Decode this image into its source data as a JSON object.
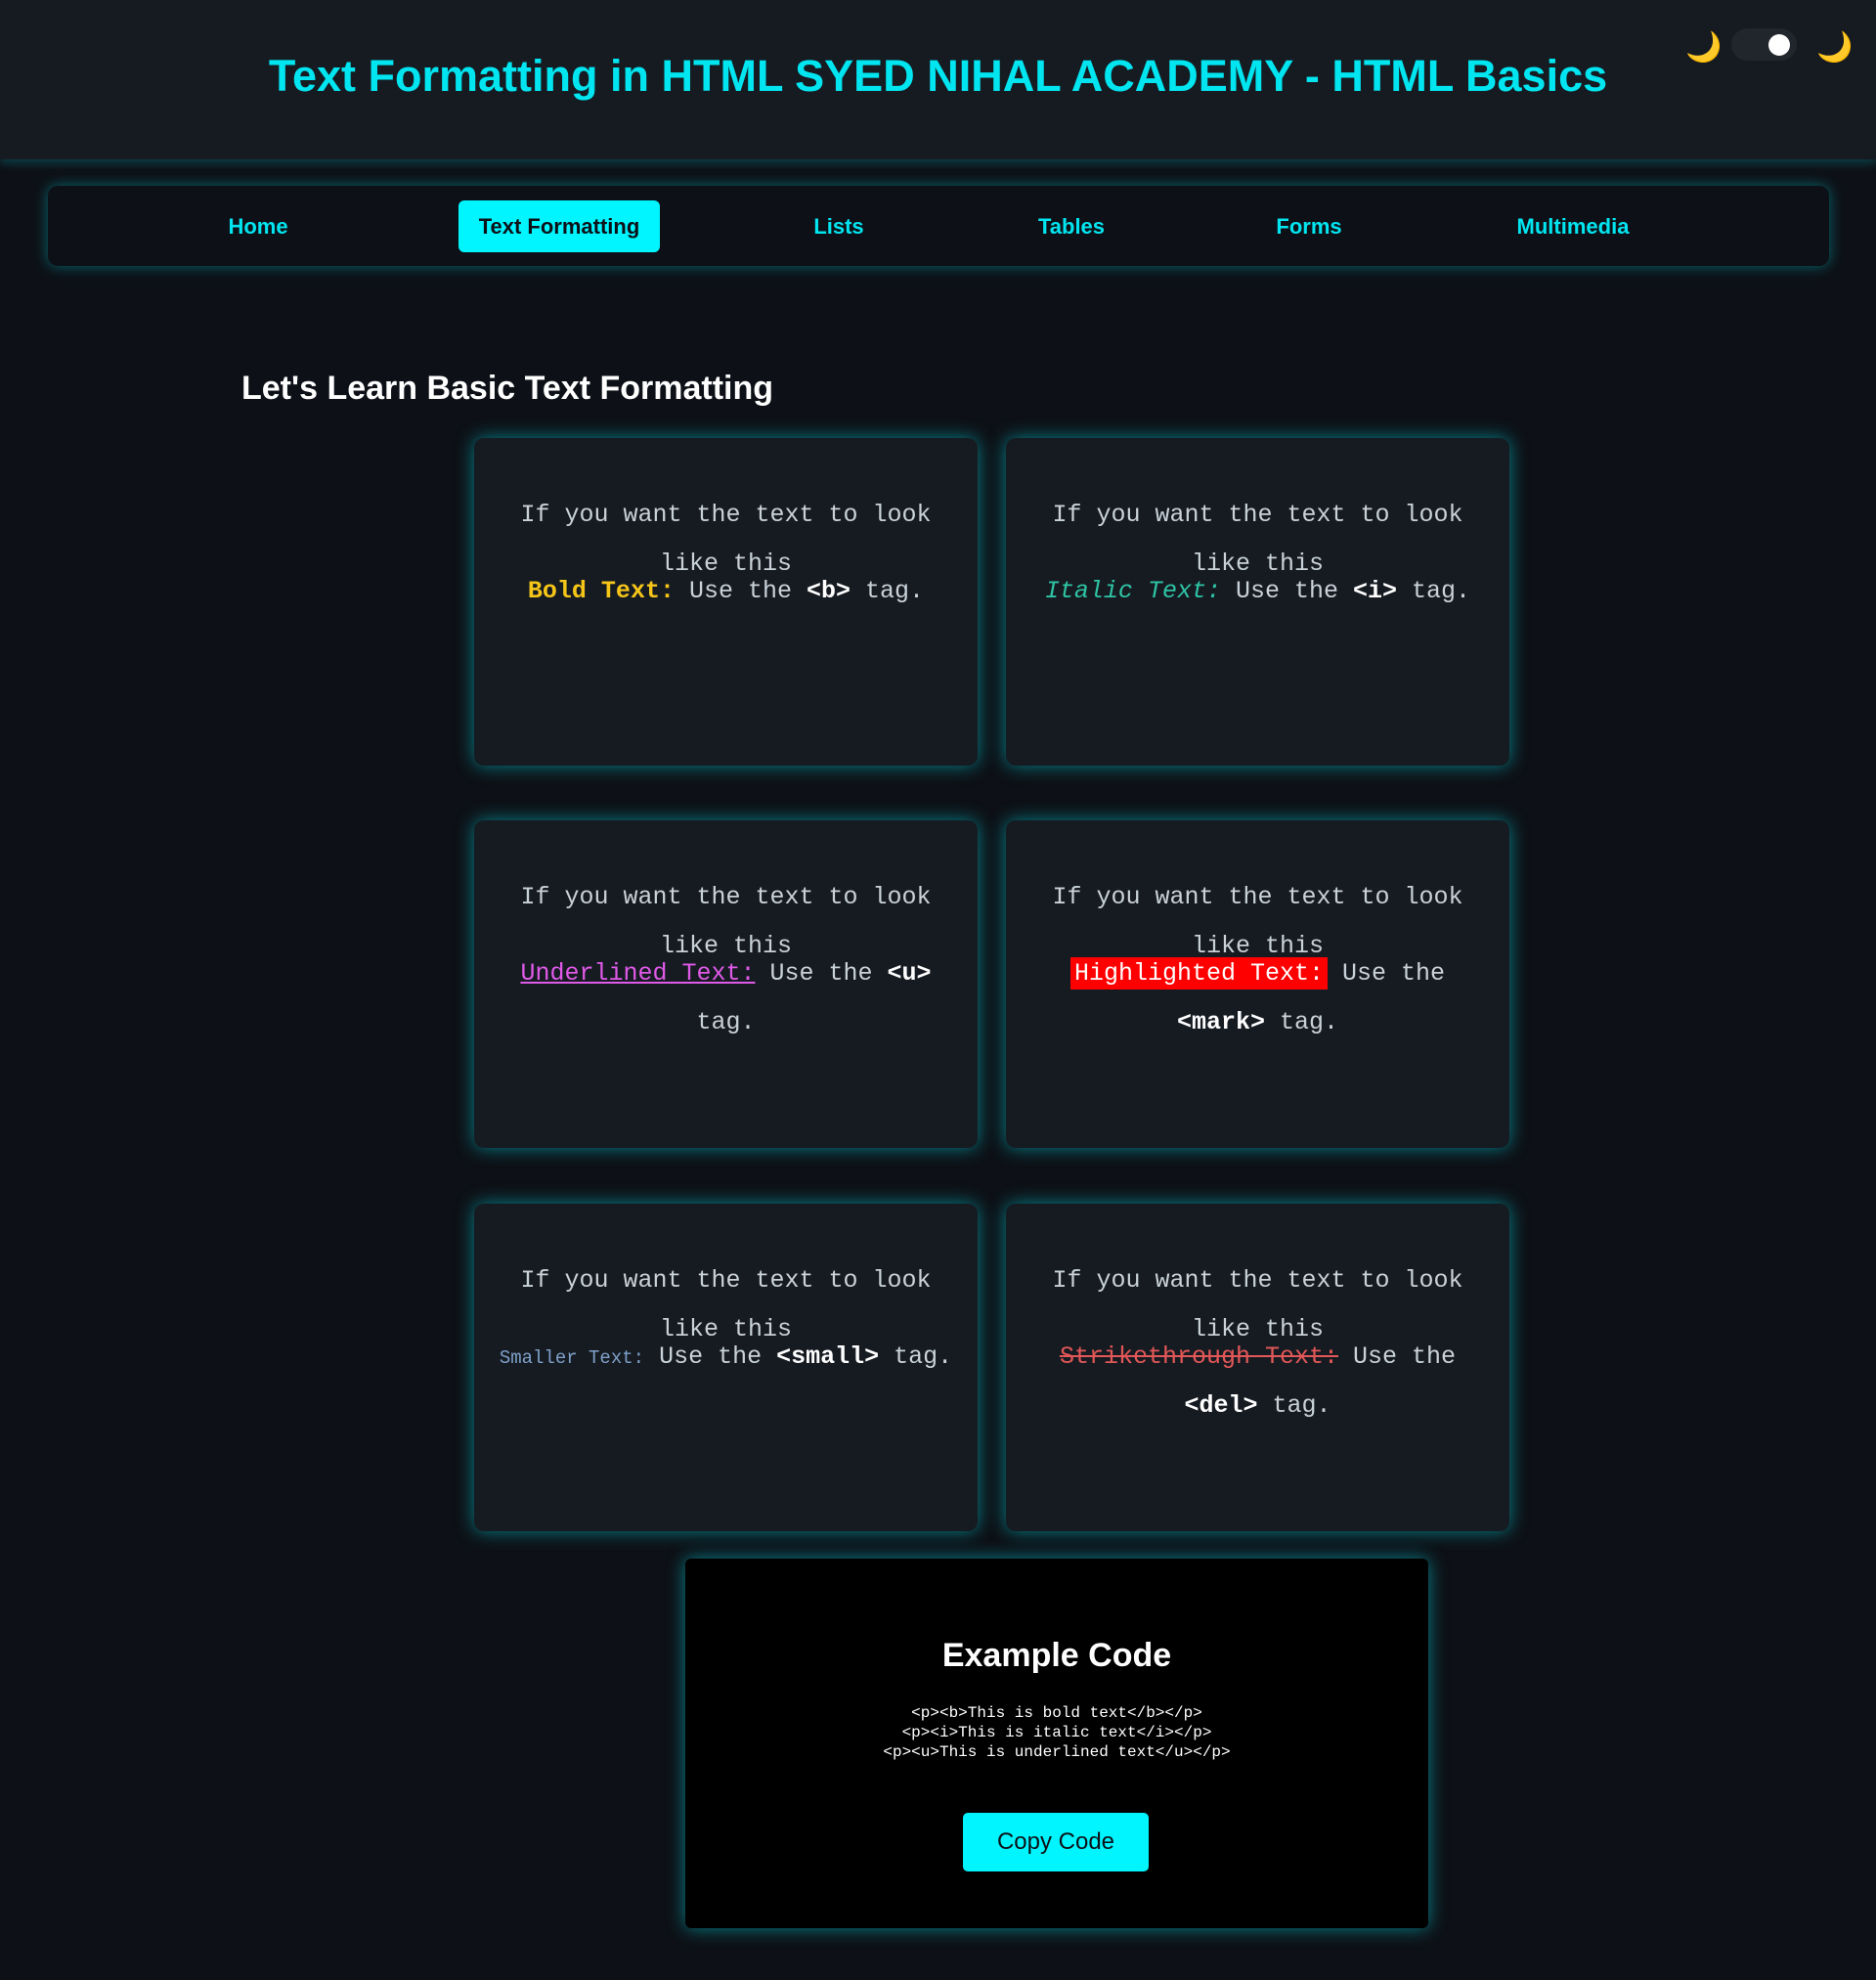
{
  "header": {
    "title": "Text Formatting in HTML SYED NIHAL ACADEMY - HTML Basics",
    "theme_toggle": {
      "left_icon": "🌙",
      "right_icon": "🌙",
      "state": "on"
    }
  },
  "nav": {
    "items": [
      {
        "label": "Home"
      },
      {
        "label": "Text Formatting",
        "active": true
      },
      {
        "label": "Lists"
      },
      {
        "label": "Tables"
      },
      {
        "label": "Forms"
      },
      {
        "label": "Multimedia"
      }
    ]
  },
  "main": {
    "heading": "Let's Learn Basic Text Formatting",
    "cards": [
      {
        "intro": "If you want the text to look like this",
        "label": "Bold Text:",
        "use": "Use the",
        "tag": "<b>",
        "suffix": "tag."
      },
      {
        "intro": "If you want the text to look like this",
        "label": "Italic Text:",
        "use": "Use the",
        "tag": "<i>",
        "suffix": "tag."
      },
      {
        "intro": "If you want the text to look like this",
        "label": "Underlined Text:",
        "use": "Use the",
        "tag": "<u>",
        "suffix": "tag."
      },
      {
        "intro": "If you want the text to look like this",
        "label": "Highlighted Text:",
        "use": "Use the",
        "tag": "<mark>",
        "suffix": "tag."
      },
      {
        "intro": "If you want the text to look like this",
        "label": "Smaller Text:",
        "use": "Use the",
        "tag": "<small>",
        "suffix": "tag."
      },
      {
        "intro": "If you want the text to look like this",
        "label": "Strikethrough Text:",
        "use": "Use the",
        "tag": "<del>",
        "suffix": "tag."
      }
    ]
  },
  "example": {
    "title": "Example Code",
    "lines": [
      "<p><b>This is bold text</b></p>",
      "<p><i>This is italic text</i></p>",
      "<p><u>This is underlined text</u></p>"
    ],
    "copy_label": "Copy Code"
  },
  "colors": {
    "accent": "#00f5ff",
    "background": "#0d1117",
    "card": "#161b22",
    "bold": "#f5c518",
    "italic": "#2ec4a4",
    "underline": "#e05ae8",
    "highlight": "#ff0000",
    "small": "#7ea0c8",
    "strike": "#e25757"
  }
}
